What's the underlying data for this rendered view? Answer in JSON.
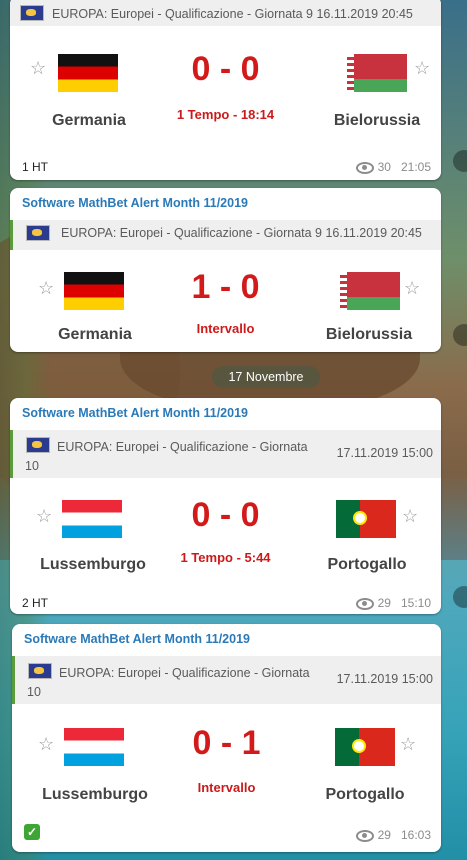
{
  "date_separator": "17 Novembre",
  "messages": [
    {
      "sender": "",
      "header": "EUROPA: Europei - Qualificazione - Giornata 9",
      "header_date": "16.11.2019 20:45",
      "home_team": "Germania",
      "away_team": "Bielorussia",
      "score": "0 - 0",
      "status": "1 Tempo - 18:14",
      "footer_left": "1 HT",
      "views": "30",
      "time": "21:05"
    },
    {
      "sender": "Software MathBet Alert Month 11/2019",
      "header": "EUROPA: Europei - Qualificazione - Giornata 9",
      "header_date": "16.11.2019 20:45",
      "home_team": "Germania",
      "away_team": "Bielorussia",
      "score": "1 - 0",
      "status": "Intervallo"
    },
    {
      "sender": "Software MathBet Alert Month 11/2019",
      "header": "EUROPA: Europei - Qualificazione - Giornata 10",
      "header_date": "17.11.2019 15:00",
      "home_team": "Lussemburgo",
      "away_team": "Portogallo",
      "score": "0 - 0",
      "status": "1 Tempo - 5:44",
      "footer_left": "2 HT",
      "views": "29",
      "time": "15:10"
    },
    {
      "sender": "Software MathBet Alert Month 11/2019",
      "header": "EUROPA: Europei - Qualificazione - Giornata 10",
      "header_date": "17.11.2019 15:00",
      "home_team": "Lussemburgo",
      "away_team": "Portogallo",
      "score": "0 - 1",
      "status": "Intervallo",
      "footer_icon": "check-mark-icon",
      "views": "29",
      "time": "16:03"
    }
  ],
  "colors": {
    "sender": "#2a7ab8",
    "score": "#d31a1a",
    "accent_bar": "#5a9c3c"
  },
  "icons": {
    "star": "star-icon",
    "views": "eye-icon",
    "competition": "europe-flag-icon"
  }
}
